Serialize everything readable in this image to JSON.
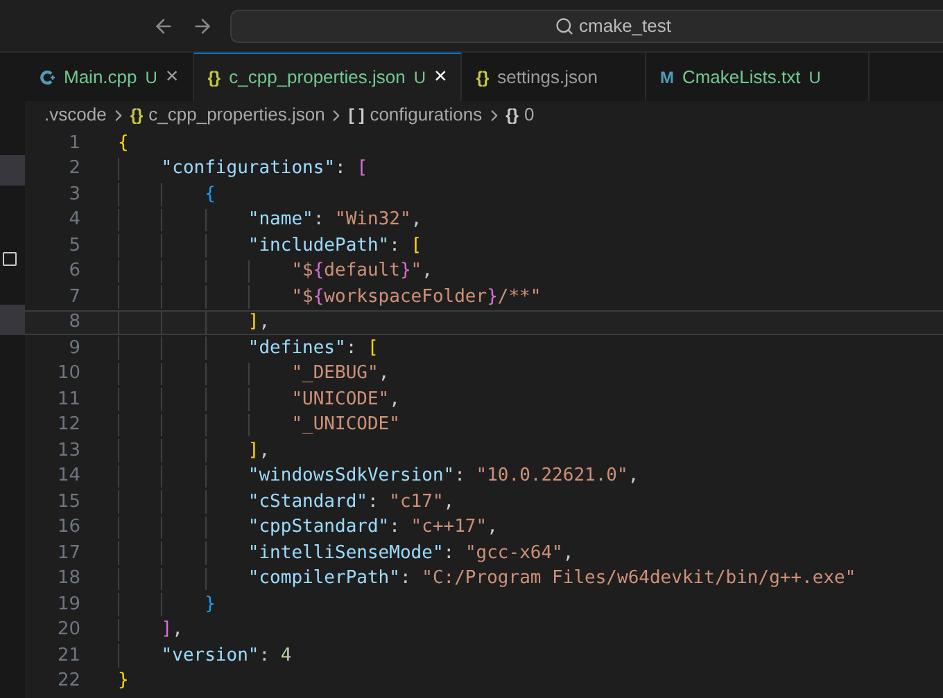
{
  "title_bar": {
    "search": "cmake_test"
  },
  "tabs": [
    {
      "kind": "cpp",
      "label": "Main.cpp",
      "status": "U",
      "close": "×",
      "selected": false
    },
    {
      "kind": "json",
      "glyph": "{}",
      "label": "c_cpp_properties.json",
      "status": "U",
      "close": "×",
      "selected": true
    },
    {
      "kind": "json",
      "glyph": "{}",
      "label": "settings.json",
      "selected": false
    },
    {
      "kind": "cmake",
      "glyph": "M",
      "label": "CmakeLists.txt",
      "status": "U",
      "selected": false
    }
  ],
  "breadcrumb": [
    {
      "label": ".vscode"
    },
    {
      "glyph": "{}",
      "kind": "json",
      "label": "c_cpp_properties.json"
    },
    {
      "glyph": "[ ]",
      "kind": "plain",
      "label": "configurations"
    },
    {
      "glyph": "{}",
      "kind": "plain",
      "label": "0"
    }
  ],
  "editor": {
    "lines": [
      {
        "number": "1",
        "current": false,
        "tokens": [
          {
            "kind": "bracket",
            "text": "{",
            "color": "#ffd700"
          }
        ]
      },
      {
        "number": "2",
        "current": false,
        "tokens": [
          {
            "kind": "key",
            "text": "    \"configurations\""
          },
          {
            "kind": "punct",
            "text": ": "
          },
          {
            "kind": "bracket",
            "text": "[",
            "color": "#da70d6"
          }
        ]
      },
      {
        "number": "3",
        "current": false,
        "tokens": [
          {
            "kind": "bracket",
            "text": "        {",
            "color": "#179fff"
          }
        ]
      },
      {
        "number": "4",
        "current": false,
        "tokens": [
          {
            "kind": "key",
            "text": "            \"name\""
          },
          {
            "kind": "punct",
            "text": ": "
          },
          {
            "kind": "string",
            "text": "\"Win32\""
          },
          {
            "kind": "punct",
            "text": ","
          }
        ]
      },
      {
        "number": "5",
        "current": false,
        "tokens": [
          {
            "kind": "key",
            "text": "            \"includePath\""
          },
          {
            "kind": "punct",
            "text": ": "
          },
          {
            "kind": "bracket",
            "text": "[",
            "color": "#ffd700"
          }
        ]
      },
      {
        "number": "6",
        "current": false,
        "tokens": [
          {
            "kind": "string",
            "text": "                \"$"
          },
          {
            "kind": "bracket",
            "text": "{",
            "color": "#da70d6"
          },
          {
            "kind": "string",
            "text": "default"
          },
          {
            "kind": "bracket",
            "text": "}",
            "color": "#da70d6"
          },
          {
            "kind": "string",
            "text": "\""
          },
          {
            "kind": "punct",
            "text": ","
          }
        ]
      },
      {
        "number": "7",
        "current": false,
        "tokens": [
          {
            "kind": "string",
            "text": "                \"$"
          },
          {
            "kind": "bracket",
            "text": "{",
            "color": "#da70d6"
          },
          {
            "kind": "string",
            "text": "workspaceFolder"
          },
          {
            "kind": "bracket",
            "text": "}",
            "color": "#da70d6"
          },
          {
            "kind": "string",
            "text": "/**\""
          }
        ]
      },
      {
        "number": "8",
        "current": true,
        "tokens": [
          {
            "kind": "bracket",
            "text": "            ]",
            "color": "#ffd700"
          },
          {
            "kind": "punct",
            "text": ","
          }
        ]
      },
      {
        "number": "9",
        "current": false,
        "tokens": [
          {
            "kind": "key",
            "text": "            \"defines\""
          },
          {
            "kind": "punct",
            "text": ": "
          },
          {
            "kind": "bracket",
            "text": "[",
            "color": "#ffd700"
          }
        ]
      },
      {
        "number": "10",
        "current": false,
        "tokens": [
          {
            "kind": "string",
            "text": "                \"_DEBUG\""
          },
          {
            "kind": "punct",
            "text": ","
          }
        ]
      },
      {
        "number": "11",
        "current": false,
        "tokens": [
          {
            "kind": "string",
            "text": "                \"UNICODE\""
          },
          {
            "kind": "punct",
            "text": ","
          }
        ]
      },
      {
        "number": "12",
        "current": false,
        "tokens": [
          {
            "kind": "string",
            "text": "                \"_UNICODE\""
          }
        ]
      },
      {
        "number": "13",
        "current": false,
        "tokens": [
          {
            "kind": "bracket",
            "text": "            ]",
            "color": "#ffd700"
          },
          {
            "kind": "punct",
            "text": ","
          }
        ]
      },
      {
        "number": "14",
        "current": false,
        "tokens": [
          {
            "kind": "key",
            "text": "            \"windowsSdkVersion\""
          },
          {
            "kind": "punct",
            "text": ": "
          },
          {
            "kind": "string",
            "text": "\"10.0.22621.0\""
          },
          {
            "kind": "punct",
            "text": ","
          }
        ]
      },
      {
        "number": "15",
        "current": false,
        "tokens": [
          {
            "kind": "key",
            "text": "            \"cStandard\""
          },
          {
            "kind": "punct",
            "text": ": "
          },
          {
            "kind": "string",
            "text": "\"c17\""
          },
          {
            "kind": "punct",
            "text": ","
          }
        ]
      },
      {
        "number": "16",
        "current": false,
        "tokens": [
          {
            "kind": "key",
            "text": "            \"cppStandard\""
          },
          {
            "kind": "punct",
            "text": ": "
          },
          {
            "kind": "string",
            "text": "\"c++17\""
          },
          {
            "kind": "punct",
            "text": ","
          }
        ]
      },
      {
        "number": "17",
        "current": false,
        "tokens": [
          {
            "kind": "key",
            "text": "            \"intelliSenseMode\""
          },
          {
            "kind": "punct",
            "text": ": "
          },
          {
            "kind": "string",
            "text": "\"gcc-x64\""
          },
          {
            "kind": "punct",
            "text": ","
          }
        ]
      },
      {
        "number": "18",
        "current": false,
        "tokens": [
          {
            "kind": "key",
            "text": "            \"compilerPath\""
          },
          {
            "kind": "punct",
            "text": ": "
          },
          {
            "kind": "string",
            "text": "\"C:/Program Files/w64devkit/bin/g++.exe\""
          }
        ]
      },
      {
        "number": "19",
        "current": false,
        "tokens": [
          {
            "kind": "bracket",
            "text": "        }",
            "color": "#179fff"
          }
        ]
      },
      {
        "number": "20",
        "current": false,
        "tokens": [
          {
            "kind": "bracket",
            "text": "    ]",
            "color": "#da70d6"
          },
          {
            "kind": "punct",
            "text": ","
          }
        ]
      },
      {
        "number": "21",
        "current": false,
        "tokens": [
          {
            "kind": "key",
            "text": "    \"version\""
          },
          {
            "kind": "punct",
            "text": ": "
          },
          {
            "kind": "number",
            "text": "4"
          }
        ]
      },
      {
        "number": "22",
        "current": false,
        "tokens": [
          {
            "kind": "bracket",
            "text": "}",
            "color": "#ffd700"
          }
        ]
      }
    ]
  }
}
